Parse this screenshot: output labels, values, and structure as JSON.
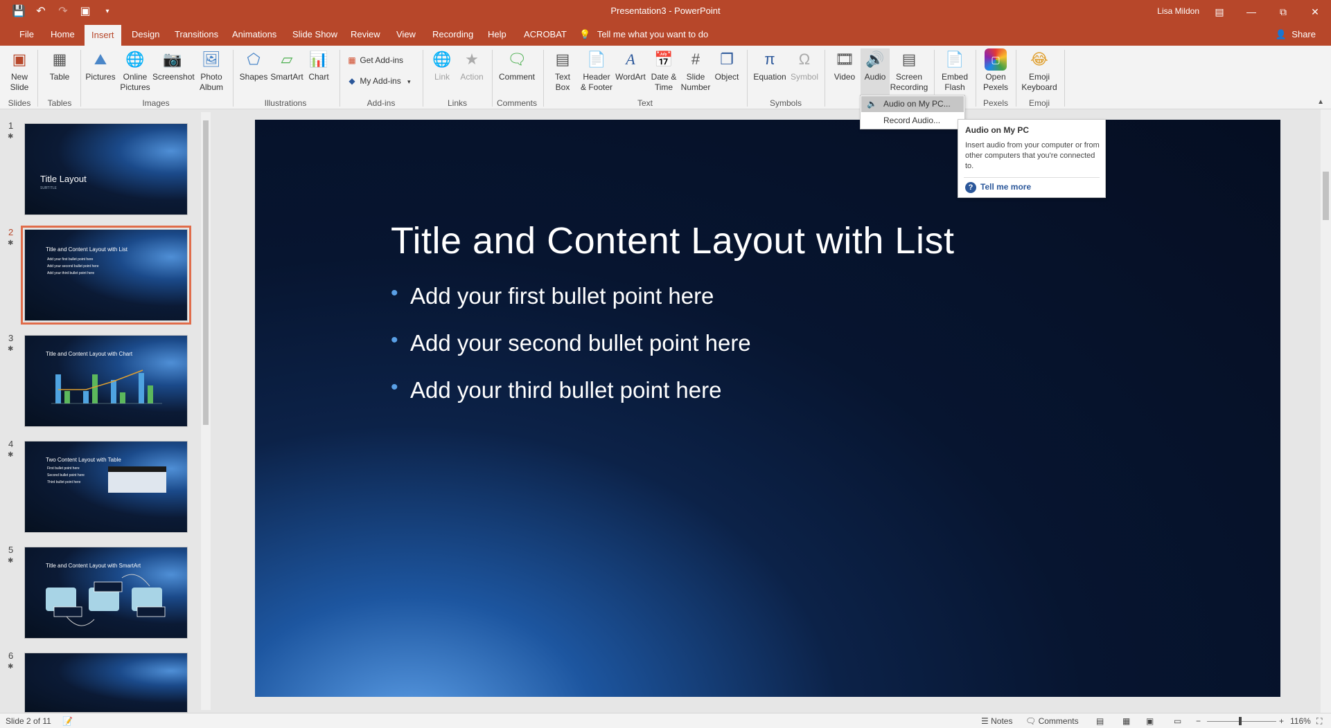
{
  "window": {
    "title": "Presentation3  -  PowerPoint",
    "user": "Lisa Mildon",
    "accent": "#b7472a"
  },
  "qat": [
    "save-icon",
    "undo-icon",
    "redo-icon",
    "start-from-beginning-icon",
    "customize-qat-icon"
  ],
  "tabs": [
    "File",
    "Home",
    "Insert",
    "Design",
    "Transitions",
    "Animations",
    "Slide Show",
    "Review",
    "View",
    "Recording",
    "Help",
    "ACROBAT"
  ],
  "active_tab": "Insert",
  "tellme": "Tell me what you want to do",
  "share": "Share",
  "ribbon": {
    "new_slide": "New\nSlide",
    "table": "Table",
    "pictures": "Pictures",
    "online_pictures": "Online\nPictures",
    "screenshot": "Screenshot",
    "photo_album": "Photo\nAlbum",
    "shapes": "Shapes",
    "smartart": "SmartArt",
    "chart": "Chart",
    "get_addins": "Get Add-ins",
    "my_addins": "My Add-ins",
    "link": "Link",
    "action": "Action",
    "comment": "Comment",
    "text_box": "Text\nBox",
    "header_footer": "Header\n& Footer",
    "wordart": "WordArt",
    "date_time": "Date &\nTime",
    "slide_number": "Slide\nNumber",
    "object": "Object",
    "equation": "Equation",
    "symbol": "Symbol",
    "video": "Video",
    "audio": "Audio",
    "screen_recording": "Screen\nRecording",
    "embed_flash": "Embed\nFlash",
    "open_pexels": "Open\nPexels",
    "emoji_keyboard": "Emoji\nKeyboard",
    "groups": {
      "slides": "Slides",
      "tables": "Tables",
      "images": "Images",
      "illustrations": "Illustrations",
      "addins": "Add-ins",
      "links": "Links",
      "comments": "Comments",
      "text": "Text",
      "symbols": "Symbols",
      "pexels": "Pexels",
      "emoji": "Emoji"
    }
  },
  "audio_menu": {
    "items": [
      "Audio on My PC...",
      "Record Audio..."
    ]
  },
  "tooltip": {
    "title": "Audio on My PC",
    "body": "Insert audio from your computer or from other computers that you're connected to.",
    "link": "Tell me more"
  },
  "thumbnails": [
    {
      "num": "1",
      "title": "Title Layout",
      "sub": "SUBTITLE"
    },
    {
      "num": "2",
      "title": "Title and Content Layout with List",
      "bullets": [
        "Add your first bullet point here",
        "Add your second bullet point here",
        "Add your third bullet point here"
      ]
    },
    {
      "num": "3",
      "title": "Title and Content Layout with Chart"
    },
    {
      "num": "4",
      "title": "Two Content Layout with Table",
      "bullets": [
        "First bullet point here",
        "Second bullet point here",
        "Third bullet point here"
      ]
    },
    {
      "num": "5",
      "title": "Title and Content Layout with SmartArt"
    },
    {
      "num": "6",
      "title": ""
    }
  ],
  "slide": {
    "title": "Title and Content Layout with List",
    "bullets": [
      "Add your first bullet point here",
      "Add your second bullet point here",
      "Add your third bullet point here"
    ]
  },
  "status": {
    "slide_of": "Slide 2 of 11",
    "notes": "Notes",
    "comments": "Comments",
    "zoom": "116%"
  }
}
